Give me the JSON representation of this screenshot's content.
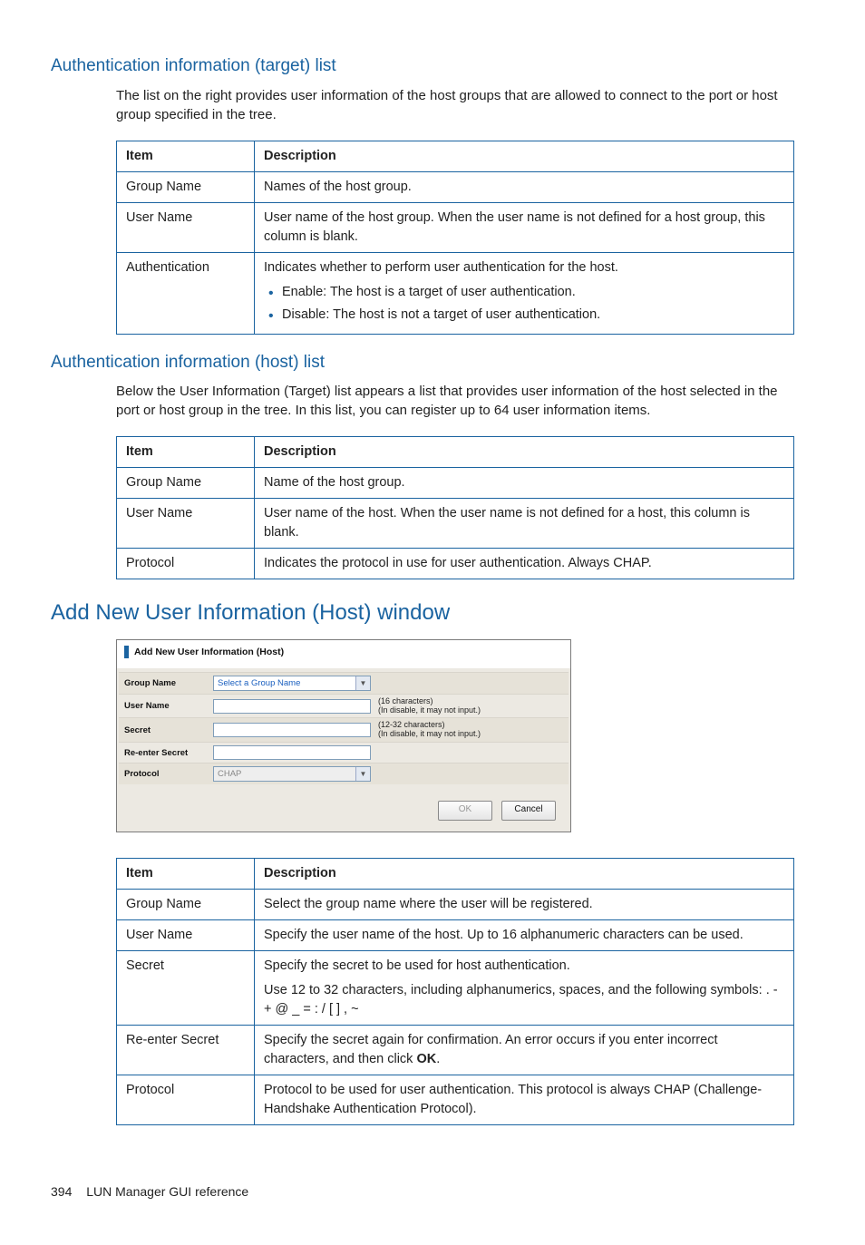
{
  "section1": {
    "heading": "Authentication information (target) list",
    "intro": "The list on the right provides user information of the host groups that are allowed to connect to the port or host group specified in the tree.",
    "th_item": "Item",
    "th_desc": "Description",
    "rows": [
      {
        "item": "Group Name",
        "desc": "Names of the host group."
      },
      {
        "item": "User Name",
        "desc": "User name of the host group. When the user name is not defined for a host group, this column is blank."
      },
      {
        "item": "Authentication",
        "desc_intro": "Indicates whether to perform user authentication for the host.",
        "bullet1": "Enable: The host is a target of user authentication.",
        "bullet2": "Disable: The host is not a target of user authentication."
      }
    ]
  },
  "section2": {
    "heading": "Authentication information (host) list",
    "intro": "Below the User Information (Target) list appears a list that provides user information of the host selected in the port or host group in the tree. In this list, you can register up to 64 user information items.",
    "th_item": "Item",
    "th_desc": "Description",
    "rows": [
      {
        "item": "Group Name",
        "desc": "Name of the host group."
      },
      {
        "item": "User Name",
        "desc": "User name of the host. When the user name is not defined for a host, this column is blank."
      },
      {
        "item": "Protocol",
        "desc": "Indicates the protocol in use for user authentication. Always CHAP."
      }
    ]
  },
  "section3": {
    "heading": "Add New User Information (Host) window",
    "dialog": {
      "title": "Add New User Information (Host)",
      "labels": {
        "group": "Group Name",
        "user": "User Name",
        "secret": "Secret",
        "resecret": "Re-enter Secret",
        "protocol": "Protocol"
      },
      "group_placeholder": "Select a Group Name",
      "protocol_value": "CHAP",
      "help_user_line1": "(16 characters)",
      "help_user_line2": "(In disable, it may not input.)",
      "help_secret_line1": "(12-32 characters)",
      "help_secret_line2": "(In disable, it may not input.)",
      "ok": "OK",
      "cancel": "Cancel"
    },
    "th_item": "Item",
    "th_desc": "Description",
    "rows": [
      {
        "item": "Group Name",
        "desc": "Select the group name where the user will be registered."
      },
      {
        "item": "User Name",
        "desc": "Specify the user name of the host. Up to 16 alphanumeric characters can be used."
      },
      {
        "item": "Secret",
        "desc_l1": "Specify the secret to be used for host authentication.",
        "desc_l2": "Use 12 to 32 characters, including alphanumerics, spaces, and the following symbols: . - + @ _ = : / [ ] , ~"
      },
      {
        "item": "Re-enter Secret",
        "desc_pre": "Specify the secret again for confirmation. An error occurs if you enter incorrect characters, and then click ",
        "desc_bold": "OK",
        "desc_post": "."
      },
      {
        "item": "Protocol",
        "desc": "Protocol to be used for user authentication. This protocol is always CHAP (Challenge-Handshake Authentication Protocol)."
      }
    ]
  },
  "footer": {
    "page": "394",
    "title": "LUN Manager GUI reference"
  }
}
